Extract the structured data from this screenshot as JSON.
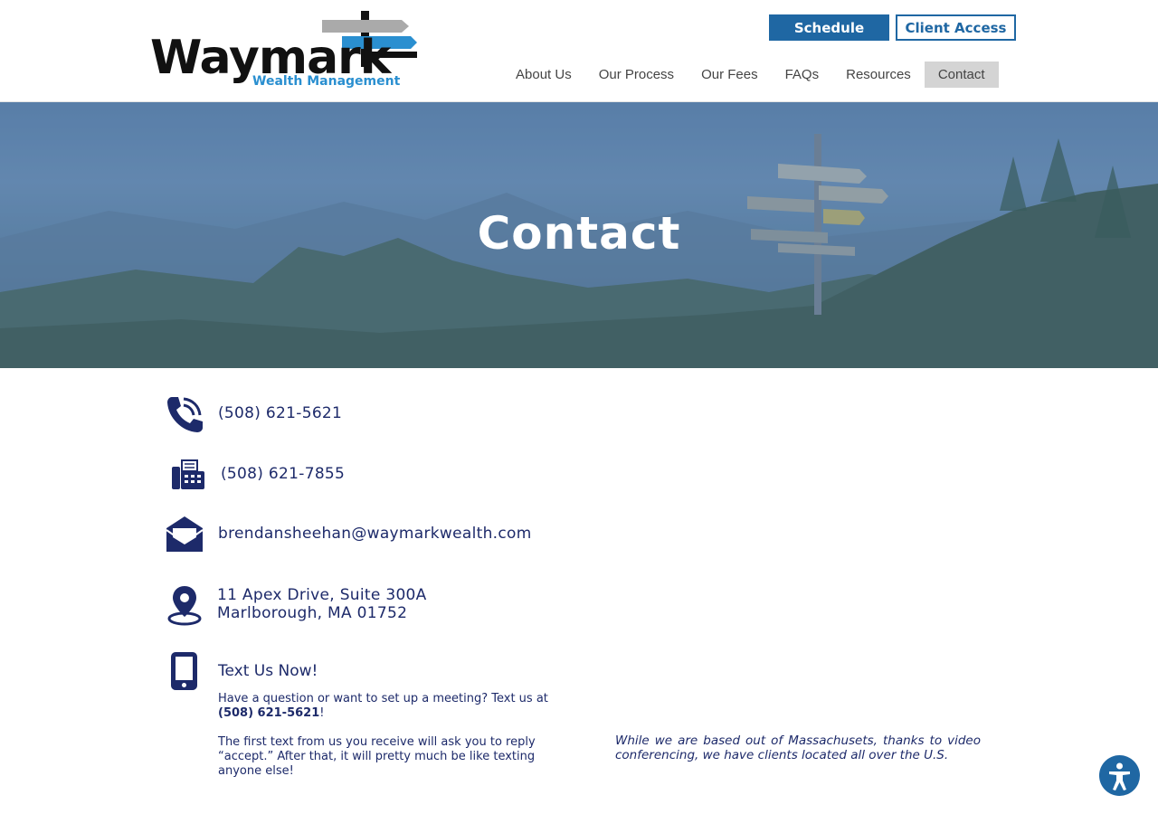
{
  "header": {
    "logo": {
      "word": "Waymark",
      "sub": "Wealth Management"
    },
    "buttons": {
      "schedule": "Schedule",
      "client_access": "Client Access"
    },
    "nav": [
      "About Us",
      "Our Process",
      "Our Fees",
      "FAQs",
      "Resources",
      "Contact"
    ],
    "active_nav": "Contact"
  },
  "hero": {
    "title": "Contact"
  },
  "contact": {
    "phone": "(508) 621-5621",
    "fax": "(508) 621-7855",
    "email": "brendansheehan@waymarkwealth.com",
    "address_line1": "11 Apex Drive, Suite 300A",
    "address_line2": "Marlborough, MA 01752",
    "text_heading": "Text Us Now!",
    "text_p1_prefix": "Have a question or want to set up a meeting? Text us at ",
    "text_p1_number": "(508) 621-5621",
    "text_p1_suffix": "!",
    "text_p2": "The first text from us you receive will ask you to reply “accept.” After that, it will pretty much be like texting anyone else!"
  },
  "note": "While we are based out of Massachusets, thanks to video conferencing, we have clients located all over the U.S.",
  "colors": {
    "brand_blue": "#1f67a3",
    "navy_text": "#1d2a6a",
    "logo_light_blue": "#2a8fd0"
  },
  "icons": [
    "phone-icon",
    "fax-icon",
    "email-icon",
    "location-icon",
    "mobile-icon",
    "accessibility-icon"
  ]
}
